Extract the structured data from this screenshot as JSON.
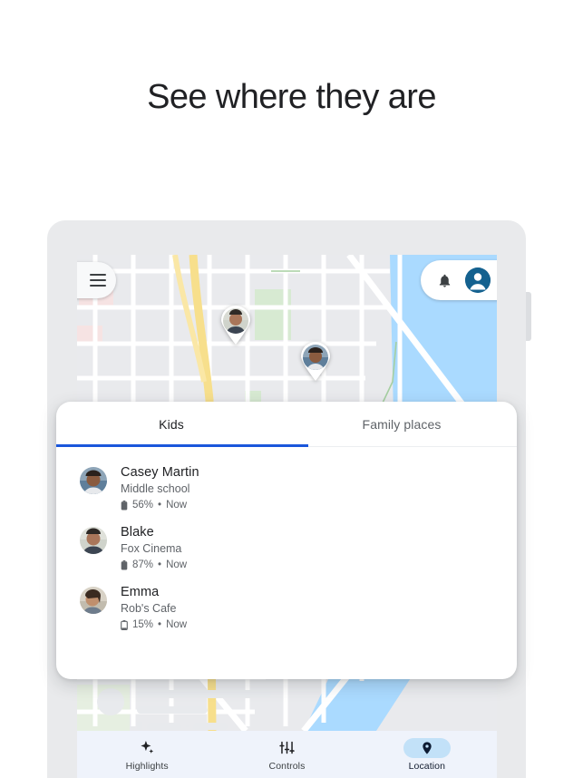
{
  "headline": "See where they are",
  "map": {
    "menu_icon": "hamburger-menu-icon",
    "notifications_icon": "bell-icon",
    "account_icon": "account-avatar-icon",
    "pins": [
      {
        "name": "Blake",
        "icon": "map-pin-avatar"
      },
      {
        "name": "Casey Martin",
        "icon": "map-pin-avatar"
      }
    ]
  },
  "sheet": {
    "tabs": [
      {
        "label": "Kids",
        "active": true
      },
      {
        "label": "Family places",
        "active": false
      }
    ],
    "accent_color": "#1a56db",
    "people": [
      {
        "name": "Casey Martin",
        "place": "Middle school",
        "battery": "56%",
        "separator": "•",
        "time": "Now",
        "battery_icon": "battery-icon"
      },
      {
        "name": "Blake",
        "place": "Fox Cinema",
        "battery": "87%",
        "separator": "•",
        "time": "Now",
        "battery_icon": "battery-icon"
      },
      {
        "name": "Emma",
        "place": "Rob's Cafe",
        "battery": "15%",
        "separator": "•",
        "time": "Now",
        "battery_icon": "battery-icon"
      }
    ]
  },
  "bottom_nav": {
    "active_pill_color": "#c2e1f8",
    "items": [
      {
        "label": "Highlights",
        "icon": "sparkle-icon",
        "active": false
      },
      {
        "label": "Controls",
        "icon": "tune-sliders-icon",
        "active": false
      },
      {
        "label": "Location",
        "icon": "location-pin-icon",
        "active": true
      }
    ]
  }
}
